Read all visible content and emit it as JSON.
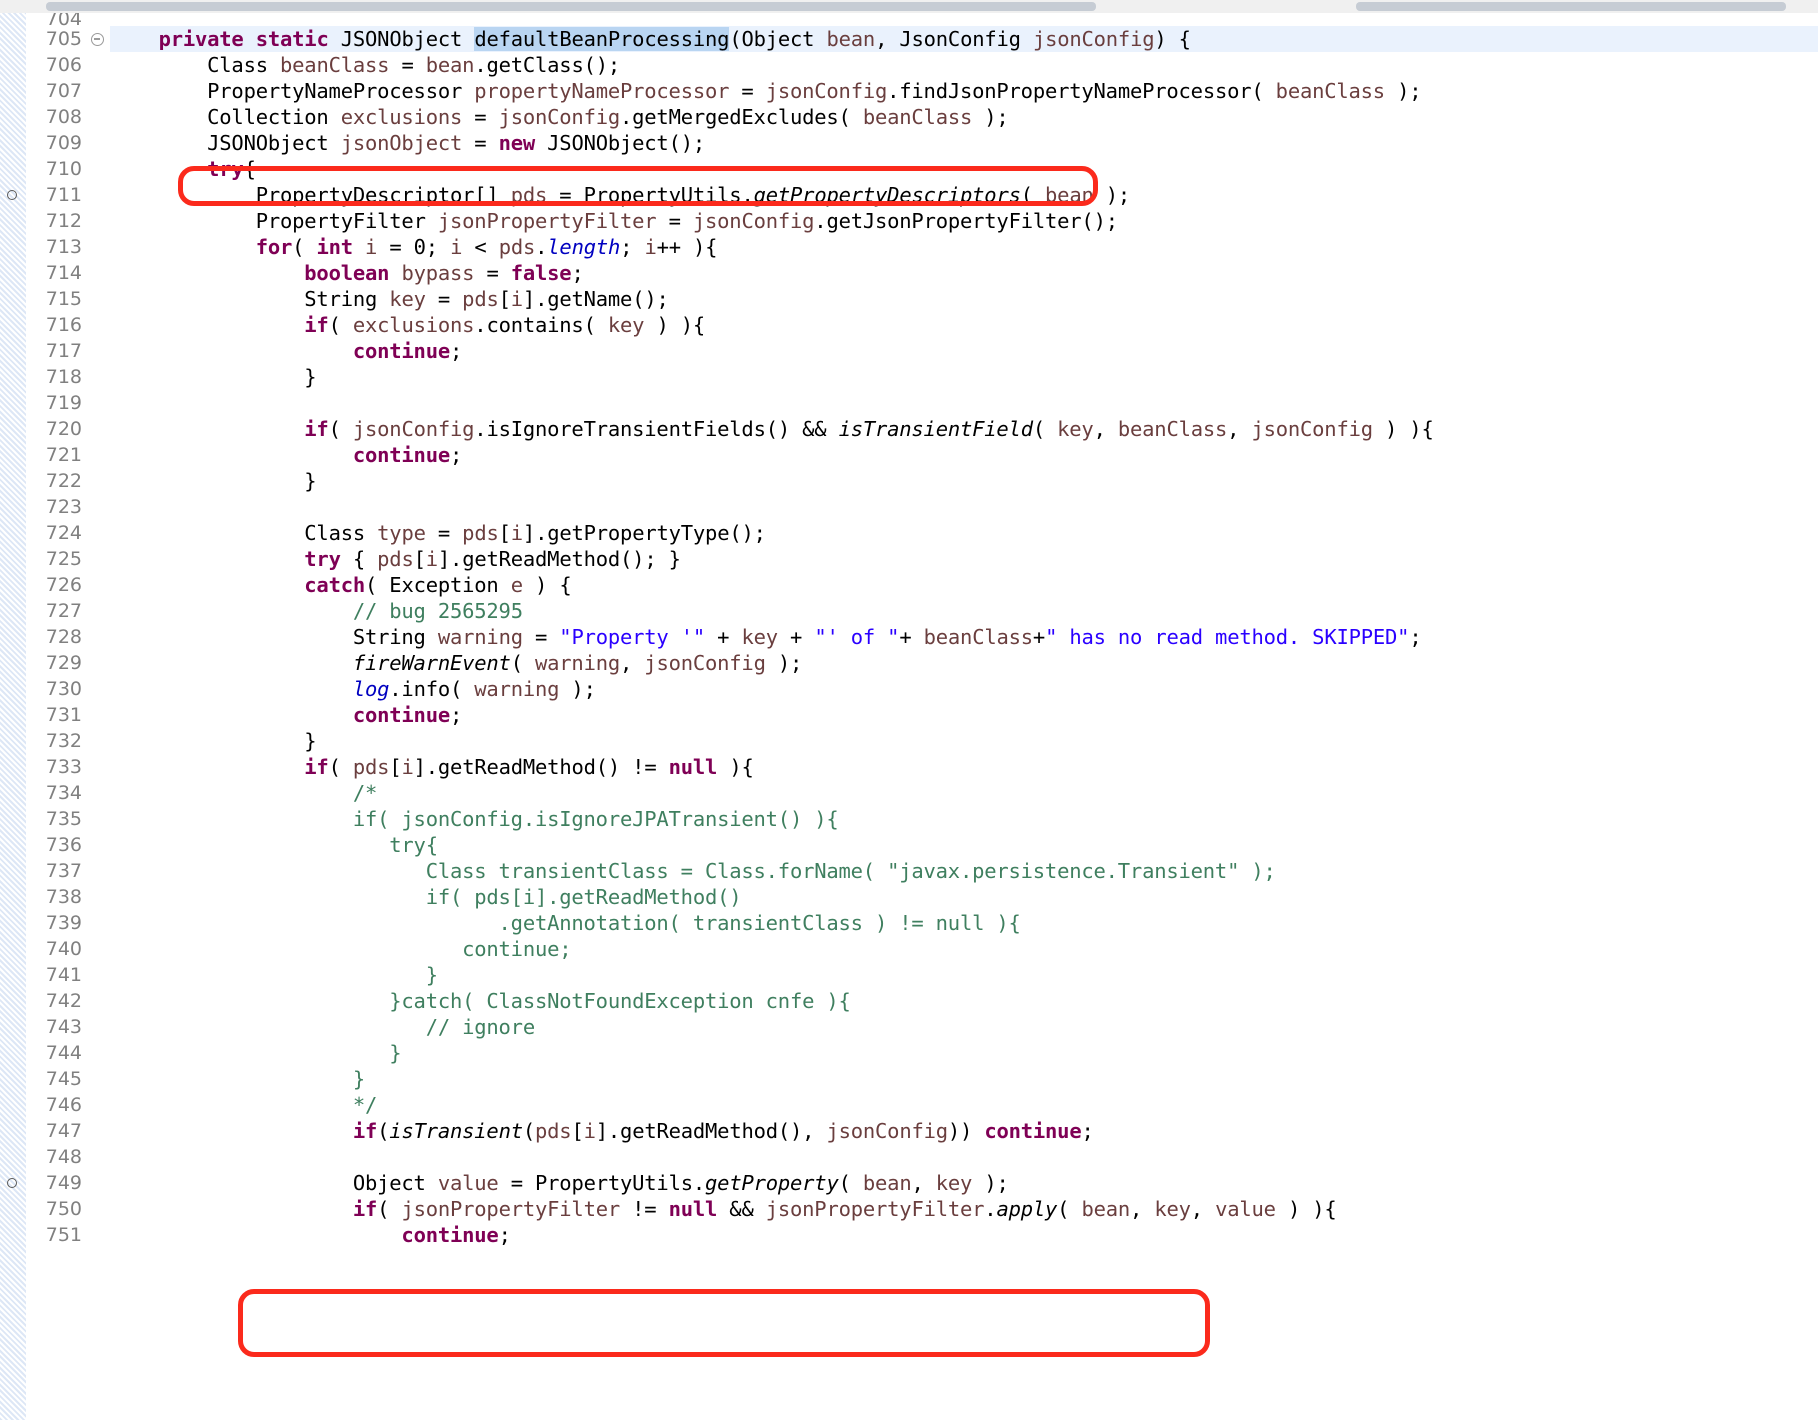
{
  "app": {
    "kind": "java-source-editor",
    "top_scrollbar": {
      "present": true
    }
  },
  "colors": {
    "keyword": "#7f0055",
    "string": "#2a00ff",
    "comment": "#3f7f5f",
    "field": "#0000c0",
    "local_variable": "#6a3e3e",
    "plain": "#000000",
    "line_number": "#808080",
    "current_line_highlight": "#eaf2fd",
    "selection_highlight": "#b9d5f2",
    "annotation_box": "#fb2a1c",
    "editor_background": "#ffffff"
  },
  "gutter": {
    "first_partial_line": "704",
    "breakpoint_lines": [
      "711",
      "749"
    ],
    "fold_lines": [
      "705"
    ],
    "line_numbers": [
      "705",
      "706",
      "707",
      "708",
      "709",
      "710",
      "711",
      "712",
      "713",
      "714",
      "715",
      "716",
      "717",
      "718",
      "719",
      "720",
      "721",
      "722",
      "723",
      "724",
      "725",
      "726",
      "727",
      "728",
      "729",
      "730",
      "731",
      "732",
      "733",
      "734",
      "735",
      "736",
      "737",
      "738",
      "739",
      "740",
      "741",
      "742",
      "743",
      "744",
      "745",
      "746",
      "747",
      "748",
      "749",
      "750",
      "751"
    ]
  },
  "annotations": [
    {
      "name": "highlight-box-line-711",
      "label": "PropertyDescriptor[] pds = PropertyUtils.getPropertyDescriptors( bean );"
    },
    {
      "name": "highlight-box-line-749",
      "label": "Object value = PropertyUtils.getProperty( bean, key );"
    }
  ],
  "code": {
    "language": "Java",
    "selected_token": "defaultBeanProcessing",
    "lines": [
      {
        "n": "704",
        "partial": true,
        "current": false,
        "text": ""
      },
      {
        "n": "705",
        "current": true,
        "text": "    private static JSONObject defaultBeanProcessing(Object bean, JsonConfig jsonConfig) {"
      },
      {
        "n": "706",
        "text": "        Class beanClass = bean.getClass();"
      },
      {
        "n": "707",
        "text": "        PropertyNameProcessor propertyNameProcessor = jsonConfig.findJsonPropertyNameProcessor( beanClass );"
      },
      {
        "n": "708",
        "text": "        Collection exclusions = jsonConfig.getMergedExcludes( beanClass );"
      },
      {
        "n": "709",
        "text": "        JSONObject jsonObject = new JSONObject();"
      },
      {
        "n": "710",
        "text": "        try{"
      },
      {
        "n": "711",
        "text": "            PropertyDescriptor[] pds = PropertyUtils.getPropertyDescriptors( bean );"
      },
      {
        "n": "712",
        "text": "            PropertyFilter jsonPropertyFilter = jsonConfig.getJsonPropertyFilter();"
      },
      {
        "n": "713",
        "text": "            for( int i = 0; i < pds.length; i++ ){"
      },
      {
        "n": "714",
        "text": "                boolean bypass = false;"
      },
      {
        "n": "715",
        "text": "                String key = pds[i].getName();"
      },
      {
        "n": "716",
        "text": "                if( exclusions.contains( key ) ){"
      },
      {
        "n": "717",
        "text": "                    continue;"
      },
      {
        "n": "718",
        "text": "                }"
      },
      {
        "n": "719",
        "text": ""
      },
      {
        "n": "720",
        "text": "                if( jsonConfig.isIgnoreTransientFields() && isTransientField( key, beanClass, jsonConfig ) ){"
      },
      {
        "n": "721",
        "text": "                    continue;"
      },
      {
        "n": "722",
        "text": "                }"
      },
      {
        "n": "723",
        "text": ""
      },
      {
        "n": "724",
        "text": "                Class type = pds[i].getPropertyType();"
      },
      {
        "n": "725",
        "text": "                try { pds[i].getReadMethod(); }"
      },
      {
        "n": "726",
        "text": "                catch( Exception e ) {"
      },
      {
        "n": "727",
        "text": "                    // bug 2565295"
      },
      {
        "n": "728",
        "text": "                    String warning = \"Property '\" + key + \"' of \"+ beanClass+\" has no read method. SKIPPED\";"
      },
      {
        "n": "729",
        "text": "                    fireWarnEvent( warning, jsonConfig );"
      },
      {
        "n": "730",
        "text": "                    log.info( warning );"
      },
      {
        "n": "731",
        "text": "                    continue;"
      },
      {
        "n": "732",
        "text": "                }"
      },
      {
        "n": "733",
        "text": "                if( pds[i].getReadMethod() != null ){"
      },
      {
        "n": "734",
        "text": "                    /*"
      },
      {
        "n": "735",
        "text": "                    if( jsonConfig.isIgnoreJPATransient() ){"
      },
      {
        "n": "736",
        "text": "                       try{"
      },
      {
        "n": "737",
        "text": "                          Class transientClass = Class.forName( \"javax.persistence.Transient\" );"
      },
      {
        "n": "738",
        "text": "                          if( pds[i].getReadMethod()"
      },
      {
        "n": "739",
        "text": "                                .getAnnotation( transientClass ) != null ){"
      },
      {
        "n": "740",
        "text": "                             continue;"
      },
      {
        "n": "741",
        "text": "                          }"
      },
      {
        "n": "742",
        "text": "                       }catch( ClassNotFoundException cnfe ){"
      },
      {
        "n": "743",
        "text": "                          // ignore"
      },
      {
        "n": "744",
        "text": "                       }"
      },
      {
        "n": "745",
        "text": "                    }"
      },
      {
        "n": "746",
        "text": "                    */"
      },
      {
        "n": "747",
        "text": "                    if(isTransient(pds[i].getReadMethod(), jsonConfig)) continue;"
      },
      {
        "n": "748",
        "text": ""
      },
      {
        "n": "749",
        "text": "                    Object value = PropertyUtils.getProperty( bean, key );"
      },
      {
        "n": "750",
        "text": "                    if( jsonPropertyFilter != null && jsonPropertyFilter.apply( bean, key, value ) ){"
      },
      {
        "n": "751",
        "text": "                        continue;"
      }
    ]
  }
}
